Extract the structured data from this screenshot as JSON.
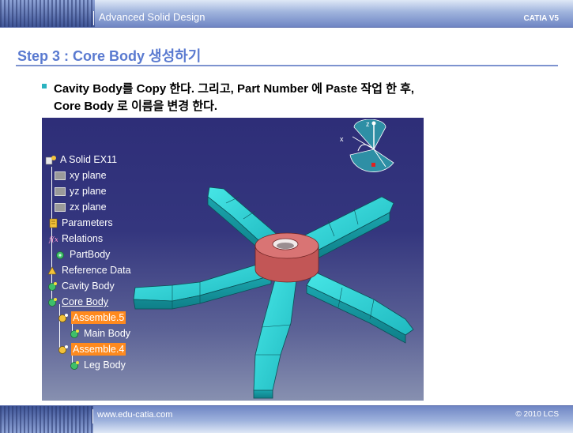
{
  "header": {
    "title": "Advanced Solid Design",
    "product": "CATIA V5"
  },
  "step_title": "Step 3 : Core Body 생성하기",
  "bullet": {
    "line1": "Cavity Body를 Copy 한다.  그리고,  Part Number 에 Paste 작업 한 후,",
    "line2": "Core Body 로 이름을 변경 한다."
  },
  "tree": {
    "root": "A Solid EX11",
    "items": [
      {
        "label": "xy plane"
      },
      {
        "label": "yz plane"
      },
      {
        "label": "zx plane"
      },
      {
        "label": "Parameters"
      },
      {
        "label": "Relations"
      },
      {
        "label": "PartBody"
      },
      {
        "label": "Reference Data"
      },
      {
        "label": "Cavity Body"
      },
      {
        "label": "Core Body"
      },
      {
        "label": "Assemble.5"
      },
      {
        "label": "Main Body"
      },
      {
        "label": "Assemble.4"
      },
      {
        "label": "Leg Body"
      }
    ]
  },
  "compass": {
    "x_label": "x",
    "z_label": "z"
  },
  "footer": {
    "url": "www.edu-catia.com",
    "copyright": "© 2010 LCS"
  },
  "colors": {
    "accent": "#5a7ad0",
    "highlight": "#ff8a1e",
    "model_cyan": "#22d0d0",
    "model_hub": "#d96a6a"
  }
}
